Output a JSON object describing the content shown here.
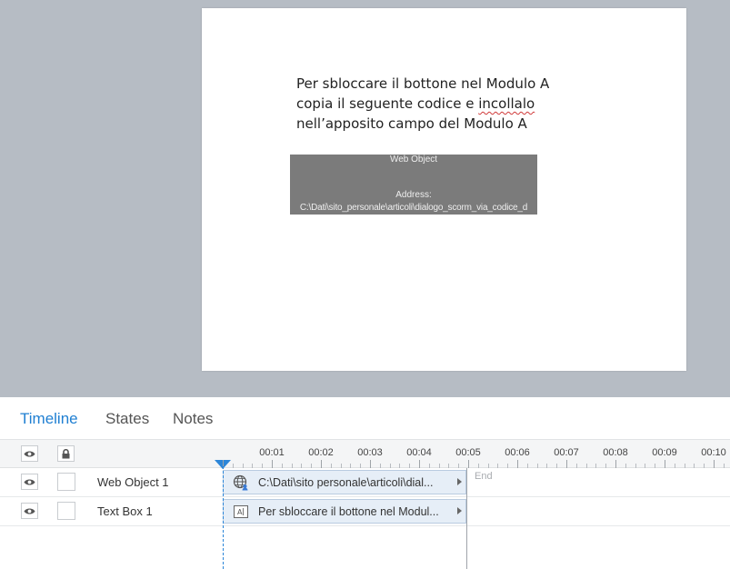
{
  "slide": {
    "text_lines": [
      "Per sbloccare il bottone nel Modulo A",
      "copia il seguente codice e ",
      "incollalo",
      "nell’apposito campo del Modulo A"
    ],
    "web_object": {
      "title": "Web Object",
      "address_label": "Address:",
      "address": "C:\\Dati\\sito_personale\\articoli\\dialogo_scorm_via_codice_d"
    }
  },
  "tabs": {
    "timeline": "Timeline",
    "states": "States",
    "notes": "Notes"
  },
  "ruler": {
    "labels": [
      "00:01",
      "00:02",
      "00:03",
      "00:04",
      "00:05",
      "00:06",
      "00:07",
      "00:08",
      "00:09",
      "00:10"
    ]
  },
  "rows": [
    {
      "name": "Web Object 1",
      "bar_text": "C:\\Dati\\sito personale\\articoli\\dial...",
      "icon": "web-object-icon"
    },
    {
      "name": "Text Box 1",
      "bar_text": "Per sbloccare il bottone nel Modul...",
      "icon": "text-box-icon"
    }
  ],
  "end_label": "End",
  "colors": {
    "accent": "#1f7fd2",
    "playhead": "#2c86d8",
    "stage": "#b6bcc4",
    "web_object_bg": "#7b7b7b",
    "bar_bg": "#e6eef7"
  }
}
